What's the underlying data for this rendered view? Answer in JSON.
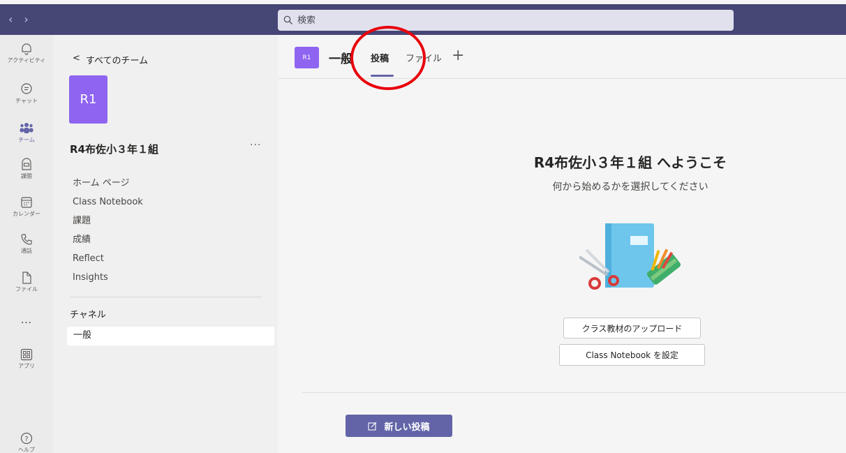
{
  "topbar": {
    "back_arrow": "‹",
    "forward_arrow": "›",
    "search_placeholder": "検索"
  },
  "rail": {
    "items": [
      {
        "label": "アクティビティ",
        "icon": "bell-icon"
      },
      {
        "label": "チャット",
        "icon": "chat-icon"
      },
      {
        "label": "チーム",
        "icon": "teams-icon",
        "active": true
      },
      {
        "label": "課題",
        "icon": "assignments-icon"
      },
      {
        "label": "カレンダー",
        "icon": "calendar-icon"
      },
      {
        "label": "通話",
        "icon": "phone-icon"
      },
      {
        "label": "ファイル",
        "icon": "file-icon"
      },
      {
        "label": "…",
        "icon": "more-icon"
      },
      {
        "label": "アプリ",
        "icon": "apps-icon"
      },
      {
        "label": "ヘルプ",
        "icon": "help-icon"
      }
    ]
  },
  "team_panel": {
    "back_label": "すべてのチーム",
    "back_chevron": "<",
    "avatar_text": "R1",
    "team_name": "R4布佐小３年１組",
    "more": "···",
    "menu": [
      "ホーム ページ",
      "Class Notebook",
      "課題",
      "成績",
      "Reflect",
      "Insights"
    ],
    "channels_heading": "チャネル",
    "channels": [
      "一般"
    ]
  },
  "main": {
    "channel_avatar": "R1",
    "channel_name": "一般",
    "tabs": [
      "投稿",
      "ファイル"
    ],
    "active_tab": "投稿",
    "add_tab": "+",
    "welcome_title": "R4布佐小３年１組 へようこそ",
    "welcome_subtitle": "何から始めるかを選択してください",
    "upload_button": "クラス教材のアップロード",
    "notebook_button": "Class Notebook を設定",
    "new_post_button": "新しい投稿"
  },
  "colors": {
    "topbar": "#464775",
    "accent": "#6264a7",
    "team_avatar": "#8e64f0",
    "annotation_circle": "#e8000b"
  }
}
